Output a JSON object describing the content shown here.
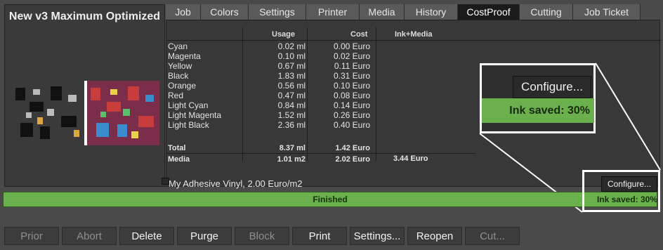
{
  "job": {
    "title": "New v3 Maximum Optimized"
  },
  "tabs": [
    {
      "label": "Job"
    },
    {
      "label": "Colors"
    },
    {
      "label": "Settings"
    },
    {
      "label": "Printer"
    },
    {
      "label": "Media"
    },
    {
      "label": "History"
    },
    {
      "label": "CostProof",
      "active": true
    },
    {
      "label": "Cutting"
    },
    {
      "label": "Job Ticket"
    }
  ],
  "table": {
    "headers": {
      "usage": "Usage",
      "cost": "Cost",
      "ink_media": "Ink+Media"
    },
    "rows": [
      {
        "name": "Cyan",
        "usage": "0.02 ml",
        "cost": "0.00 Euro"
      },
      {
        "name": "Magenta",
        "usage": "0.10 ml",
        "cost": "0.02 Euro"
      },
      {
        "name": "Yellow",
        "usage": "0.67 ml",
        "cost": "0.11 Euro"
      },
      {
        "name": "Black",
        "usage": "1.83 ml",
        "cost": "0.31 Euro"
      },
      {
        "name": "Orange",
        "usage": "0.56 ml",
        "cost": "0.10 Euro"
      },
      {
        "name": "Red",
        "usage": "0.47 ml",
        "cost": "0.08 Euro"
      },
      {
        "name": "Light Cyan",
        "usage": "0.84 ml",
        "cost": "0.14 Euro"
      },
      {
        "name": "Light Magenta",
        "usage": "1.52 ml",
        "cost": "0.26 Euro"
      },
      {
        "name": "Light Black",
        "usage": "2.36 ml",
        "cost": "0.40 Euro"
      }
    ],
    "total": {
      "name": "Total",
      "usage": "8.37 ml",
      "cost": "1.42 Euro"
    },
    "media": {
      "name": "Media",
      "usage": "1.01 m2",
      "cost": "2.02 Euro",
      "ink_media": "3.44 Euro"
    }
  },
  "media_description": "My Adhesive Vinyl, 2.00 Euro/m2",
  "configure_label": "Configure...",
  "ink_saved": "Ink saved: 30%",
  "status": "Finished",
  "colors": {
    "progress_green": "#6ab04c",
    "active_tab": "#1b1b1b",
    "panel_bg": "#383838"
  },
  "buttons": [
    {
      "label": "Prior",
      "enabled": false
    },
    {
      "label": "Abort",
      "enabled": false
    },
    {
      "label": "Delete",
      "enabled": true
    },
    {
      "label": "Purge",
      "enabled": true
    },
    {
      "label": "Block",
      "enabled": false
    },
    {
      "label": "Print",
      "enabled": true
    },
    {
      "label": "Settings...",
      "enabled": true
    },
    {
      "label": "Reopen",
      "enabled": true
    },
    {
      "label": "Cut...",
      "enabled": false
    }
  ]
}
